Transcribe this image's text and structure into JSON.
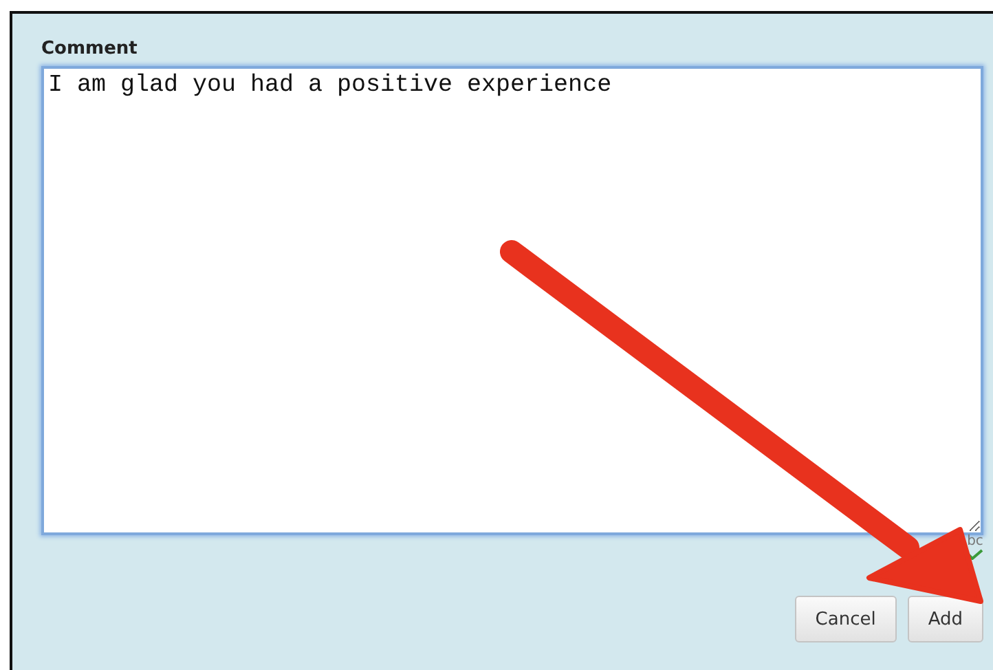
{
  "comment": {
    "label": "Comment",
    "value": "I am glad you had a positive experience",
    "spellcheck_label": "bc"
  },
  "buttons": [
    "Cancel",
    "Add"
  ]
}
